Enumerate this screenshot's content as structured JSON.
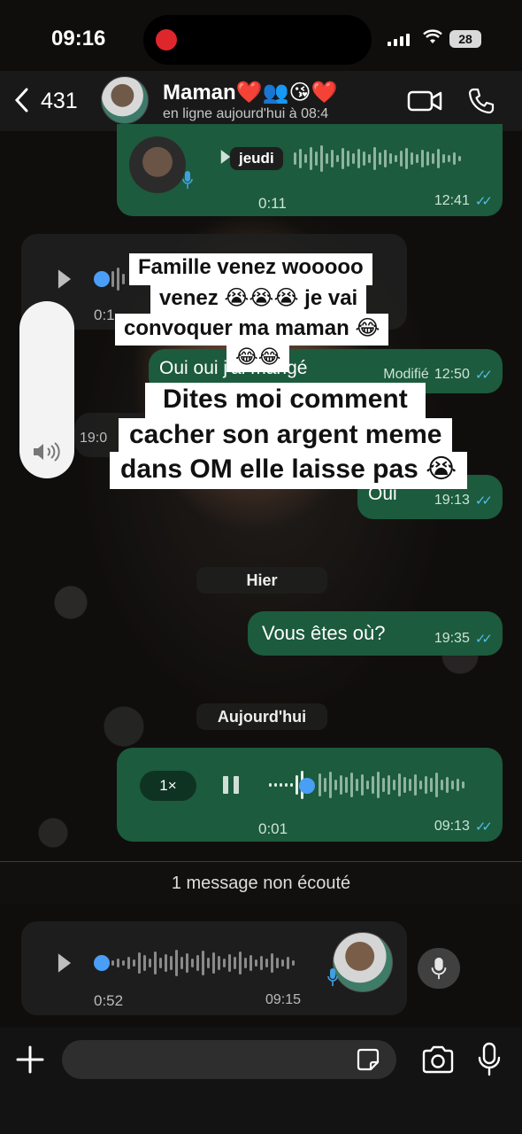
{
  "status_bar": {
    "time": "09:16",
    "battery": "28"
  },
  "header": {
    "back_count": "431",
    "contact_name": "Maman❤️👥😘❤️",
    "contact_status": "en ligne aujourd'hui à 08:4"
  },
  "messages": {
    "voice_top": {
      "duration": "0:11",
      "time": "12:41",
      "day_overlay": "jeudi"
    },
    "voice_in_1": {
      "duration": "0:1"
    },
    "text_out_1": {
      "text": "Oui oui j'ai mangé",
      "edited": "Modifié",
      "time": "12:50"
    },
    "in_partial": {
      "time": "19:0"
    },
    "text_out_2": {
      "text": "Oui",
      "time": "19:13"
    },
    "day_hier": "Hier",
    "text_out_3": {
      "text": "Vous êtes où?",
      "time": "19:35"
    },
    "day_today": "Aujourd'hui",
    "voice_playing": {
      "speed": "1×",
      "elapsed": "0:01",
      "time": "09:13"
    },
    "unread_banner": "1 message non écouté",
    "voice_in_2": {
      "duration": "0:52",
      "time": "09:15"
    }
  },
  "captions": {
    "top": [
      "Famille venez wooooo",
      "venez 😭😭😭 je vai",
      "convoquer ma maman 😂",
      "😂😂"
    ],
    "bottom": [
      "Dites moi comment",
      "cacher son argent meme",
      "dans OM elle laisse pas 😭"
    ]
  },
  "composer": {
    "placeholder": ""
  },
  "colors": {
    "outgoing_bubble": "#1c5b3d",
    "incoming_bubble": "#202020",
    "read_ticks": "#53bdeb"
  },
  "icons": [
    "back-chevron-icon",
    "video-camera-icon",
    "phone-icon",
    "play-icon",
    "pause-icon",
    "mic-icon",
    "plus-icon",
    "sticker-icon",
    "camera-icon",
    "volume-icon"
  ]
}
